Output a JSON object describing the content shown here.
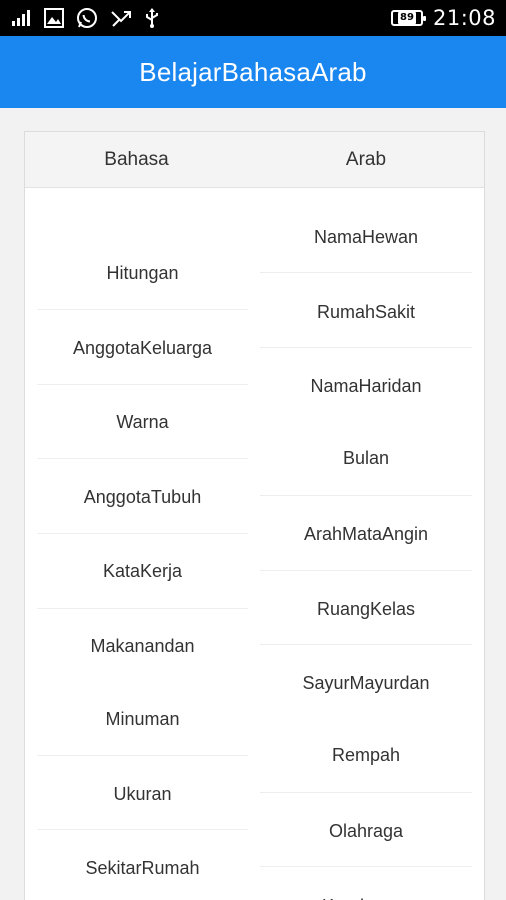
{
  "status_bar": {
    "left_icons": [
      "signal-icon",
      "image-icon",
      "whatsapp-icon",
      "missed-call-icon",
      "usb-icon"
    ],
    "battery_level": "89",
    "time": "21:08"
  },
  "app_bar": {
    "title": "BelajarBahasaArab"
  },
  "table": {
    "headers": {
      "left": "Bahasa",
      "right": "Arab"
    },
    "left_items": [
      "Hitungan",
      "AnggotaKeluarga",
      "Warna",
      "AnggotaTubuh",
      "KataKerja",
      "Makanandan",
      "Minuman",
      "Ukuran",
      "SekitarRumah"
    ],
    "right_items": [
      "NamaHewan",
      "RumahSakit",
      "NamaHaridan",
      "Bulan",
      "ArahMataAngin",
      "RuangKelas",
      "SayurMayurdan",
      "Rempah",
      "Olahraga",
      "Kendaraan"
    ]
  },
  "colors": {
    "app_bar": "#1a86f0",
    "status_bar": "#000000",
    "header_bg": "#f4f4f4"
  }
}
